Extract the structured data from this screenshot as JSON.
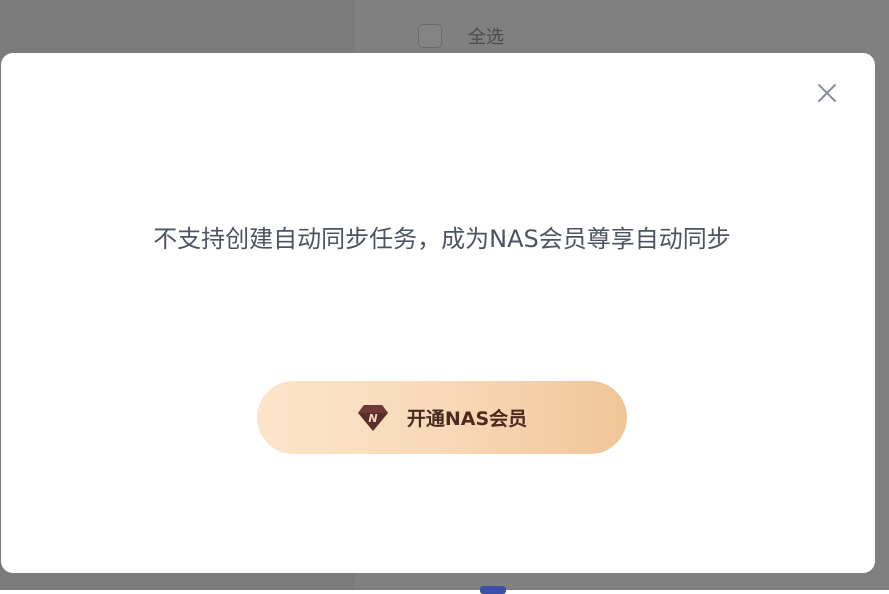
{
  "background": {
    "select_all_label": "全选"
  },
  "modal": {
    "message": "不支持创建自动同步任务，成为NAS会员尊享自动同步",
    "cta_label": "开通NAS会员",
    "cta_icon": "diamond-n-icon",
    "close_icon": "close-icon"
  },
  "colors": {
    "overlay": "#808080",
    "message_text": "#4d5461",
    "cta_gradient_start": "#fce4ca",
    "cta_gradient_end": "#f0c597",
    "cta_text": "#4a2a1f",
    "badge": "#5a2d2a"
  }
}
